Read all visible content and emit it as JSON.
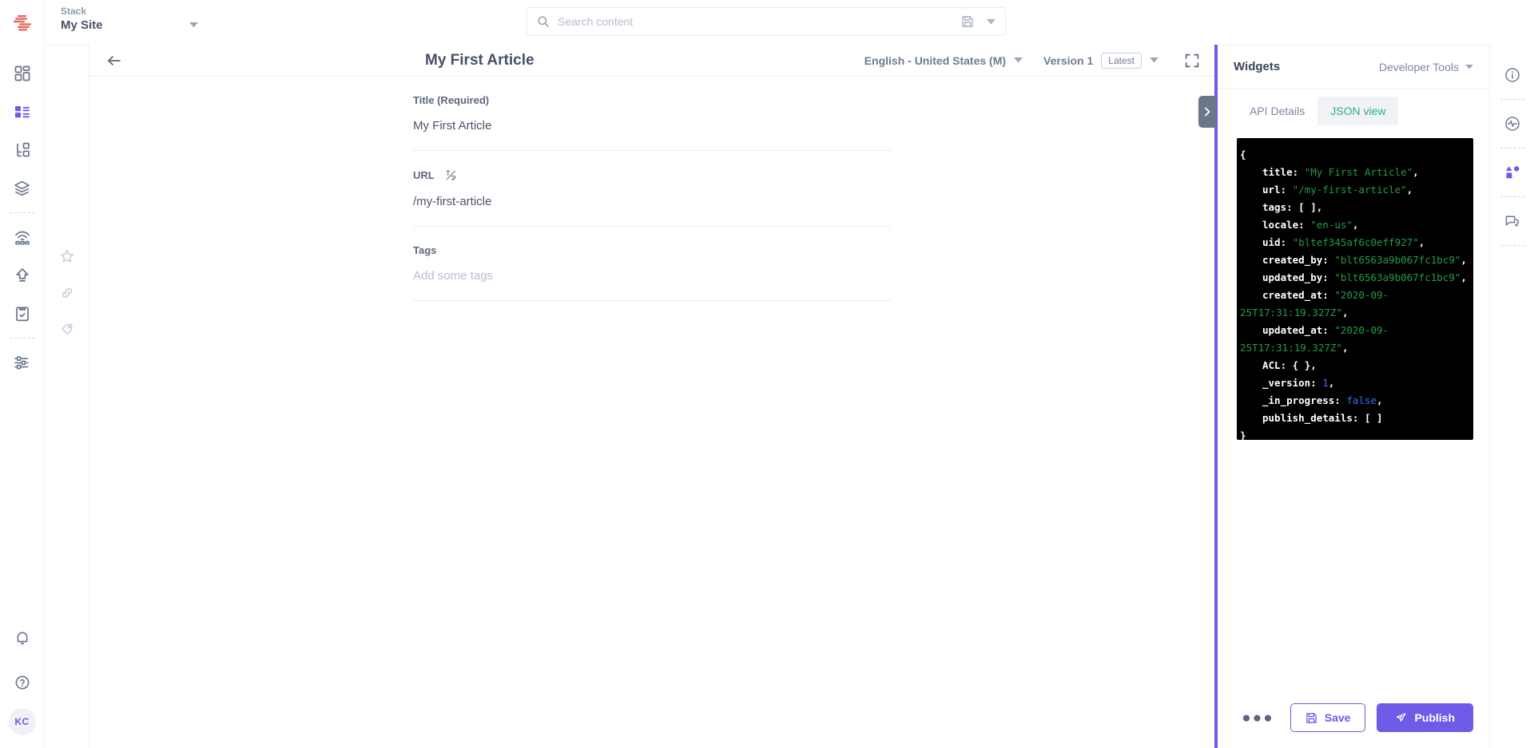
{
  "brand": {
    "logo_name": "contentstack-logo",
    "accent": "#6c5ce7",
    "logo_color": "#e4685d"
  },
  "topbar": {
    "stack_label": "Stack",
    "stack_value": "My Site",
    "stack_caret_icon": "caret-down-icon",
    "search": {
      "placeholder": "Search content",
      "value": "",
      "search_icon": "search-icon",
      "save_icon": "save-disk-icon",
      "caret_icon": "caret-down-icon"
    }
  },
  "left_rail": {
    "items": [
      {
        "name": "dashboard",
        "icon": "dashboard-grid-icon",
        "active": false
      },
      {
        "name": "entries",
        "icon": "entries-list-icon",
        "active": true
      },
      {
        "name": "content-models",
        "icon": "content-model-icon",
        "active": false
      },
      {
        "name": "assets",
        "icon": "layers-stack-icon",
        "active": false
      },
      {
        "name": "live-preview",
        "icon": "broadcast-icon",
        "active": false
      },
      {
        "name": "publish-queue",
        "icon": "upload-arrow-icon",
        "active": false
      },
      {
        "name": "release-tasks",
        "icon": "clipboard-check-icon",
        "active": false
      },
      {
        "name": "settings",
        "icon": "sliders-settings-icon",
        "active": false
      }
    ],
    "bottom": [
      {
        "name": "notifications",
        "icon": "bell-icon"
      },
      {
        "name": "help",
        "icon": "question-circle-icon"
      }
    ],
    "avatar_initials": "KC"
  },
  "editor_rail": {
    "items": [
      {
        "name": "favorite",
        "icon": "star-icon"
      },
      {
        "name": "references",
        "icon": "link-chain-icon"
      },
      {
        "name": "tags-meta",
        "icon": "tag-loop-icon"
      }
    ]
  },
  "entry_header": {
    "back_icon": "arrow-left-icon",
    "title": "My First Article",
    "locale": "English - United States (M)",
    "locale_caret_icon": "caret-down-icon",
    "version_label": "Version 1",
    "version_chip": "Latest",
    "version_caret_icon": "caret-down-icon",
    "expand_icon": "fullscreen-expand-icon"
  },
  "panel_toggle": {
    "icon": "chevron-right-icon"
  },
  "form": {
    "fields": [
      {
        "label": "Title (Required)",
        "value": "My First Article",
        "placeholder": "",
        "icon": null
      },
      {
        "label": "URL",
        "value": "/my-first-article",
        "placeholder": "",
        "icon": "auto-generate-url-icon"
      },
      {
        "label": "Tags",
        "value": "",
        "placeholder": "Add some tags",
        "icon": null
      }
    ]
  },
  "widgets": {
    "title": "Widgets",
    "devtools_label": "Developer Tools",
    "devtools_caret_icon": "caret-down-icon",
    "tabs": [
      {
        "label": "API Details",
        "active": false
      },
      {
        "label": "JSON view",
        "active": true
      }
    ],
    "json": {
      "open_brace": "{",
      "close_brace": "}",
      "entries": [
        {
          "key": "title",
          "value": "\"My First Article\"",
          "type": "string",
          "comma": true
        },
        {
          "key": "url",
          "value": "\"/my-first-article\"",
          "type": "string",
          "comma": true
        },
        {
          "key": "tags",
          "value": "[ ]",
          "type": "punc",
          "comma": true
        },
        {
          "key": "locale",
          "value": "\"en-us\"",
          "type": "string",
          "comma": true
        },
        {
          "key": "uid",
          "value": "\"bltef345af6c0eff927\"",
          "type": "string",
          "comma": true
        },
        {
          "key": "created_by",
          "value": "\"blt6563a9b067fc1bc9\"",
          "type": "string",
          "comma": true
        },
        {
          "key": "updated_by",
          "value": "\"blt6563a9b067fc1bc9\"",
          "type": "string",
          "comma": true
        },
        {
          "key": "created_at",
          "value": "\"2020-09-25T17:31:19.327Z\"",
          "type": "string",
          "comma": true
        },
        {
          "key": "updated_at",
          "value": "\"2020-09-25T17:31:19.327Z\"",
          "type": "string",
          "comma": true
        },
        {
          "key": "ACL",
          "value": "{ }",
          "type": "punc",
          "comma": true
        },
        {
          "key": "_version",
          "value": "1",
          "type": "number",
          "comma": true
        },
        {
          "key": "_in_progress",
          "value": "false",
          "type": "bool",
          "comma": true
        },
        {
          "key": "publish_details",
          "value": "[ ]",
          "type": "punc",
          "comma": false
        }
      ]
    },
    "actions": {
      "more_label": "●●●",
      "save_label": "Save",
      "save_icon": "save-disk-icon",
      "publish_label": "Publish",
      "publish_icon": "publish-rocket-icon"
    }
  },
  "util_rail": {
    "items": [
      {
        "name": "info",
        "icon": "info-circle-icon"
      },
      {
        "name": "activity",
        "icon": "activity-pulse-icon"
      },
      {
        "name": "extensions",
        "icon": "shapes-extension-icon"
      },
      {
        "name": "comments",
        "icon": "comment-bubbles-icon"
      }
    ]
  }
}
